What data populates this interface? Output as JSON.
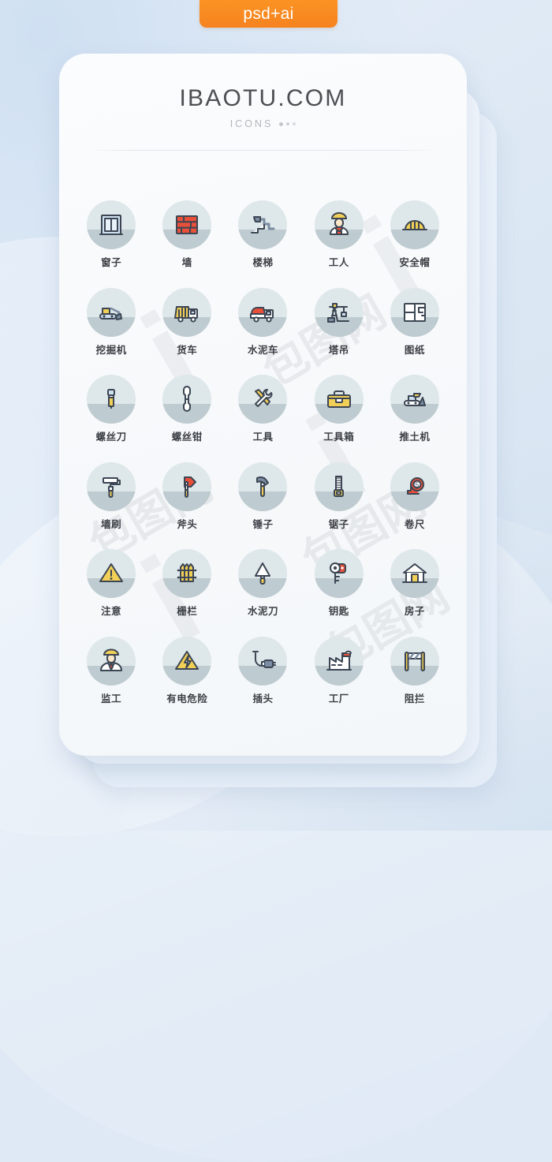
{
  "ribbon": {
    "label": "psd+ai"
  },
  "header": {
    "brand": "IBAOTU.COM",
    "subtitle": "ICONS"
  },
  "watermark": {
    "text_cn": "包图网",
    "text_mark": "i"
  },
  "icons": [
    {
      "label": "窗子",
      "name": "window-icon"
    },
    {
      "label": "墙",
      "name": "brick-wall-icon"
    },
    {
      "label": "楼梯",
      "name": "stairs-icon"
    },
    {
      "label": "工人",
      "name": "worker-icon"
    },
    {
      "label": "安全帽",
      "name": "safety-helmet-icon"
    },
    {
      "label": "挖掘机",
      "name": "excavator-icon"
    },
    {
      "label": "货车",
      "name": "dump-truck-icon"
    },
    {
      "label": "水泥车",
      "name": "cement-mixer-truck-icon"
    },
    {
      "label": "塔吊",
      "name": "tower-crane-icon"
    },
    {
      "label": "图纸",
      "name": "blueprint-icon"
    },
    {
      "label": "螺丝刀",
      "name": "screwdriver-icon"
    },
    {
      "label": "螺丝钳",
      "name": "wrench-icon"
    },
    {
      "label": "工具",
      "name": "tools-icon"
    },
    {
      "label": "工具箱",
      "name": "toolbox-icon"
    },
    {
      "label": "推土机",
      "name": "bulldozer-icon"
    },
    {
      "label": "墙刷",
      "name": "paint-roller-icon"
    },
    {
      "label": "斧头",
      "name": "axe-icon"
    },
    {
      "label": "锤子",
      "name": "hammer-icon"
    },
    {
      "label": "锯子",
      "name": "saw-icon"
    },
    {
      "label": "卷尺",
      "name": "tape-measure-icon"
    },
    {
      "label": "注意",
      "name": "warning-triangle-icon"
    },
    {
      "label": "栅栏",
      "name": "fence-icon"
    },
    {
      "label": "水泥刀",
      "name": "trowel-icon"
    },
    {
      "label": "钥匙",
      "name": "key-icon"
    },
    {
      "label": "房子",
      "name": "house-icon"
    },
    {
      "label": "监工",
      "name": "supervisor-icon"
    },
    {
      "label": "有电危险",
      "name": "electric-hazard-icon"
    },
    {
      "label": "插头",
      "name": "plug-icon"
    },
    {
      "label": "工厂",
      "name": "factory-icon"
    },
    {
      "label": "阻拦",
      "name": "barrier-icon"
    }
  ],
  "colors": {
    "ribbon": "#f5821f",
    "disc": "#dee7e9",
    "disc_shadow": "#b9c6cb",
    "outline": "#3c4654",
    "yellow": "#f2cf57",
    "red": "#e8503a",
    "blue_gray": "#7b8ca3",
    "light_blue": "#cfe0f0",
    "card": "#fbfcfd",
    "page_bg": "#dfe9f5",
    "label_text": "#3b3f45",
    "brand_text": "#4d4f52"
  }
}
